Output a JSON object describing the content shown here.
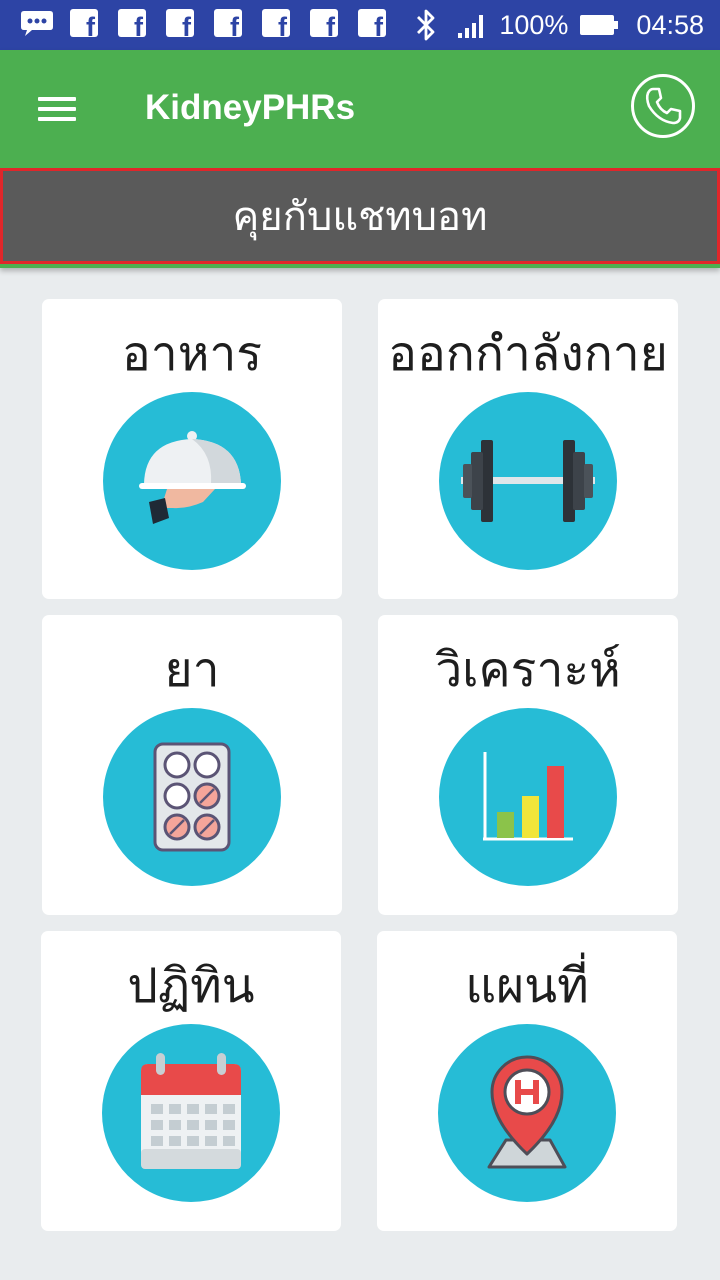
{
  "status_bar": {
    "battery": "100%",
    "time": "04:58",
    "notification_icons": [
      "message-icon",
      "facebook-icon",
      "facebook-icon",
      "facebook-icon",
      "facebook-icon",
      "facebook-icon",
      "facebook-icon",
      "facebook-icon"
    ]
  },
  "app_bar": {
    "title": "KidneyPHRs",
    "menu_icon": "hamburger-menu-icon",
    "phone_icon": "phone-icon"
  },
  "chatbot": {
    "label": "คุยกับแชทบอท"
  },
  "menu": {
    "items": [
      {
        "label": "อาหาร",
        "icon": "food-tray-icon"
      },
      {
        "label": "ออกกำลังกาย",
        "icon": "dumbbell-icon"
      },
      {
        "label": "ยา",
        "icon": "pill-pack-icon"
      },
      {
        "label": "วิเคราะห์",
        "icon": "bar-chart-icon"
      },
      {
        "label": "ปฏิทิน",
        "icon": "calendar-icon"
      },
      {
        "label": "แผนที่",
        "icon": "hospital-map-pin-icon"
      }
    ]
  },
  "colors": {
    "app_bar": "#4caf50",
    "status_bar": "#2d44a5",
    "chatbot_bar": "#5a5a5a",
    "chatbot_border": "#e0262a",
    "icon_circle": "#26bcd6",
    "background": "#e9ecee"
  }
}
